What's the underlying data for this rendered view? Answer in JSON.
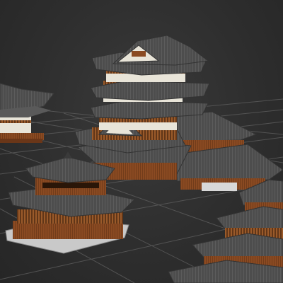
{
  "viewport": {
    "background_color": "#2b2b2b",
    "grid_color": "#5d5d5d",
    "grid_visible": true
  },
  "scene": {
    "roof_color": "#4a4a4a",
    "roof_tile_color": "#6a6a6a",
    "wood_color": "#8a4a22",
    "plaster_color": "#e8e4d8",
    "base_color": "#c9c9c9"
  },
  "models": [
    {
      "name": "main-castle-keep",
      "icon": "pagoda-icon"
    },
    {
      "name": "side-pavilion-left",
      "icon": "pagoda-icon"
    },
    {
      "name": "two-tier-pagoda",
      "icon": "pagoda-icon"
    },
    {
      "name": "multi-tier-pagoda-right",
      "icon": "pagoda-icon"
    }
  ]
}
